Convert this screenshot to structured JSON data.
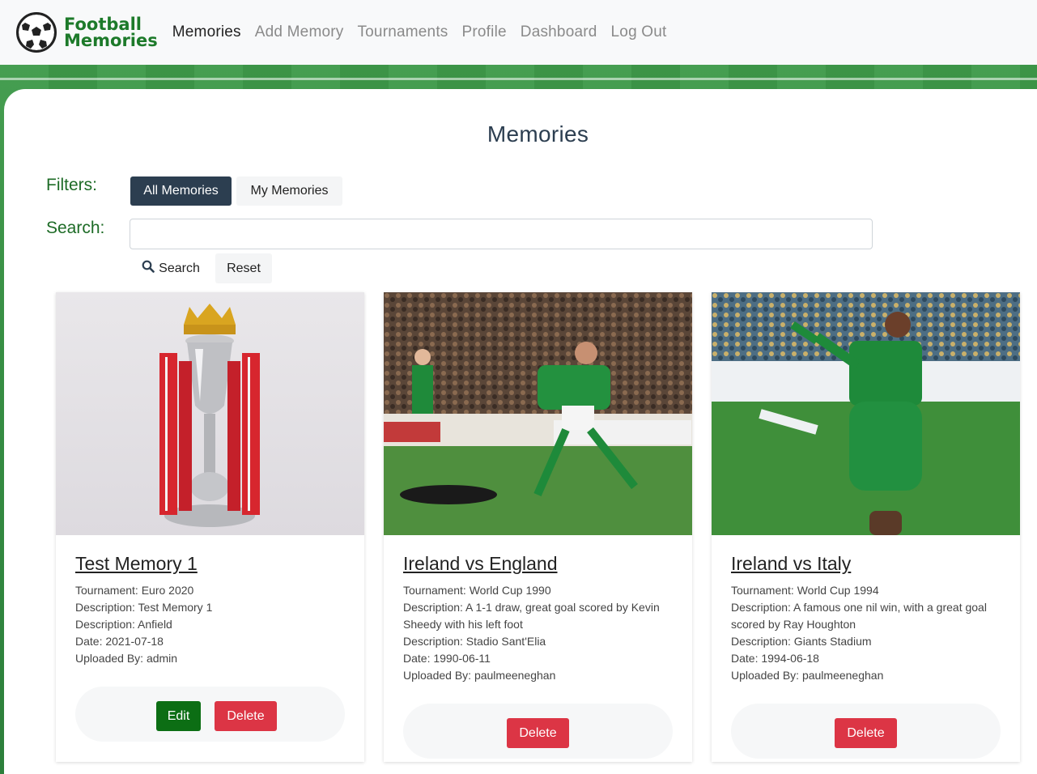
{
  "brand": {
    "line1": "Football",
    "line2": "Memories"
  },
  "nav": {
    "items": [
      {
        "label": "Memories",
        "active": true
      },
      {
        "label": "Add Memory",
        "active": false
      },
      {
        "label": "Tournaments",
        "active": false
      },
      {
        "label": "Profile",
        "active": false
      },
      {
        "label": "Dashboard",
        "active": false
      },
      {
        "label": "Log Out",
        "active": false
      }
    ]
  },
  "page": {
    "title": "Memories"
  },
  "filters": {
    "label": "Filters:",
    "all_label": "All Memories",
    "mine_label": "My Memories"
  },
  "search": {
    "label": "Search:",
    "value": "",
    "placeholder": "",
    "search_button": "Search",
    "reset_button": "Reset"
  },
  "cards": [
    {
      "title": "Test Memory 1",
      "tournament": "Tournament: Euro 2020",
      "description": "Description: Test Memory 1",
      "venue": "Description: Anfield",
      "date": "Date: 2021-07-18",
      "uploaded_by": "Uploaded By: admin",
      "edit_label": "Edit",
      "delete_label": "Delete"
    },
    {
      "title": "Ireland vs England",
      "tournament": "Tournament: World Cup 1990",
      "description": "Description: A 1-1 draw, great goal scored by Kevin Sheedy with his left foot",
      "venue": "Description: Stadio Sant'Elia",
      "date": "Date: 1990-06-11",
      "uploaded_by": "Uploaded By: paulmeeneghan",
      "delete_label": "Delete"
    },
    {
      "title": "Ireland vs Italy",
      "tournament": "Tournament: World Cup 1994",
      "description": "Description: A famous one nil win, with a great goal scored by Ray Houghton",
      "venue": "Description: Giants Stadium",
      "date": "Date: 1994-06-18",
      "uploaded_by": "Uploaded By: paulmeeneghan",
      "delete_label": "Delete"
    }
  ],
  "colors": {
    "brand_green": "#1d7a2a",
    "dark_button": "#2c3e50",
    "edit_green": "#0c6e14",
    "delete_red": "#dc3545"
  }
}
